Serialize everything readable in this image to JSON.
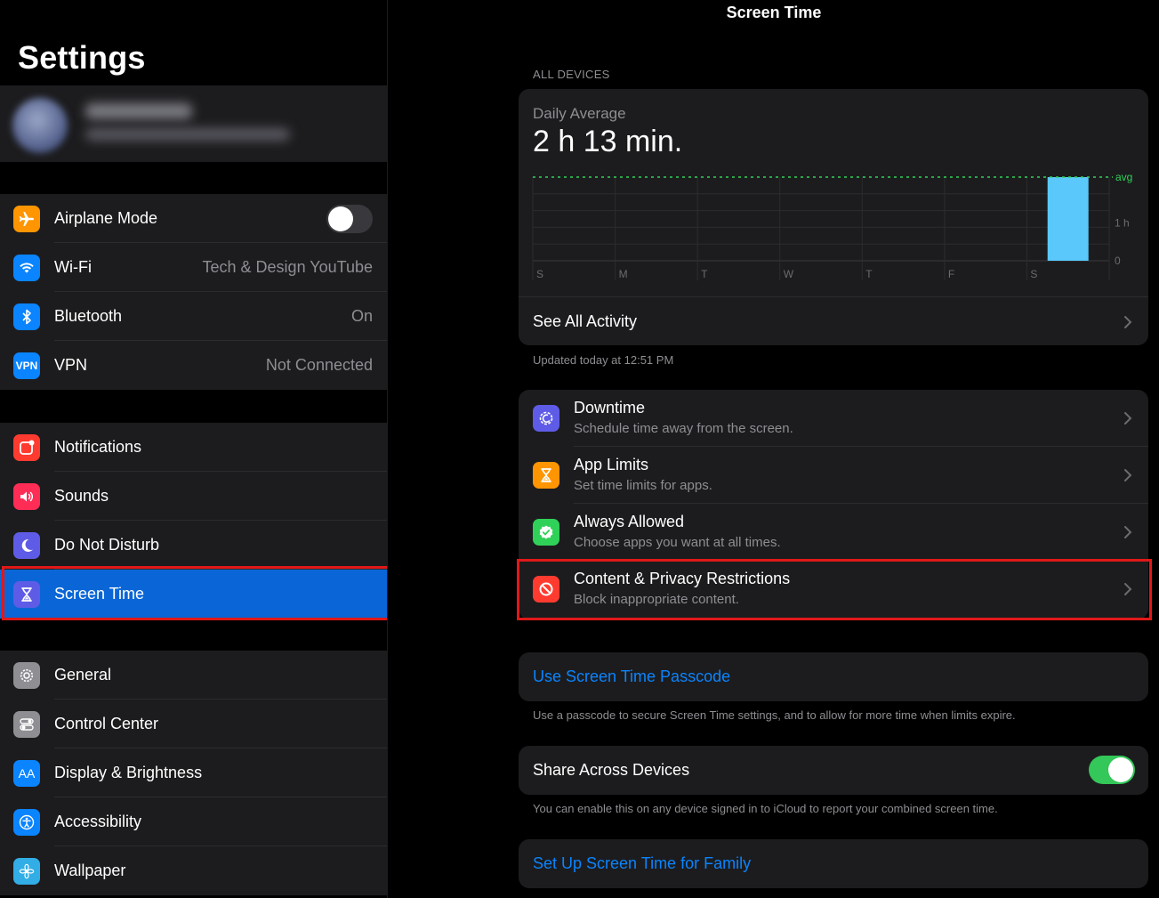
{
  "sidebar": {
    "title": "Settings",
    "group1": [
      {
        "label": "Airplane Mode",
        "icon": "airplane-icon",
        "color": "#ff9500",
        "toggle_on": false
      },
      {
        "label": "Wi-Fi",
        "value": "Tech & Design YouTube",
        "icon": "wifi-icon",
        "color": "#0a84ff"
      },
      {
        "label": "Bluetooth",
        "value": "On",
        "icon": "bluetooth-icon",
        "color": "#0a84ff"
      },
      {
        "label": "VPN",
        "value": "Not Connected",
        "icon": "vpn-icon",
        "icon_text": "VPN",
        "color": "#0a84ff"
      }
    ],
    "group2": [
      {
        "label": "Notifications",
        "icon": "notifications-icon",
        "color": "#ff3b30"
      },
      {
        "label": "Sounds",
        "icon": "speaker-icon",
        "color": "#ff2d55"
      },
      {
        "label": "Do Not Disturb",
        "icon": "moon-icon",
        "color": "#5e5ce6"
      },
      {
        "label": "Screen Time",
        "icon": "hourglass-icon",
        "color": "#5e5ce6",
        "selected": true
      }
    ],
    "group3": [
      {
        "label": "General",
        "icon": "gear-icon",
        "color": "#8e8e93"
      },
      {
        "label": "Control Center",
        "icon": "switches-icon",
        "color": "#8e8e93"
      },
      {
        "label": "Display & Brightness",
        "icon": "text-size-icon",
        "icon_text": "AA",
        "color": "#0a84ff"
      },
      {
        "label": "Accessibility",
        "icon": "accessibility-icon",
        "color": "#0a84ff"
      },
      {
        "label": "Wallpaper",
        "icon": "flower-icon",
        "color": "#32ade6"
      }
    ]
  },
  "detail": {
    "nav_title": "Screen Time",
    "section_header": "ALL DEVICES",
    "daily_average_label": "Daily Average",
    "daily_average_value": "2 h 13 min.",
    "see_all": "See All Activity",
    "updated": "Updated today at 12:51 PM",
    "options": [
      {
        "title": "Downtime",
        "subtitle": "Schedule time away from the screen.",
        "icon": "downtime-icon",
        "color": "#5e5ce6"
      },
      {
        "title": "App Limits",
        "subtitle": "Set time limits for apps.",
        "icon": "hourglass-icon",
        "color": "#ff9500"
      },
      {
        "title": "Always Allowed",
        "subtitle": "Choose apps you want at all times.",
        "icon": "checkmark-badge-icon",
        "color": "#30d158"
      },
      {
        "title": "Content & Privacy Restrictions",
        "subtitle": "Block inappropriate content.",
        "icon": "no-entry-icon",
        "color": "#ff3b30"
      }
    ],
    "passcode_link": "Use Screen Time Passcode",
    "passcode_note": "Use a passcode to secure Screen Time settings, and to allow for more time when limits expire.",
    "share_label": "Share Across Devices",
    "share_on": true,
    "share_note": "You can enable this on any device signed in to iCloud to report your combined screen time.",
    "family_link": "Set Up Screen Time for Family"
  },
  "chart_data": {
    "type": "bar",
    "categories": [
      "S",
      "M",
      "T",
      "W",
      "T",
      "F",
      "S"
    ],
    "values": [
      0,
      0,
      0,
      0,
      0,
      0,
      2.22
    ],
    "bar_color": "#5ac8fa",
    "average_label": "avg",
    "average_value": 2.22,
    "y_tick_labels": [
      "1 h",
      "0"
    ],
    "ylim": [
      0,
      2.22
    ]
  }
}
